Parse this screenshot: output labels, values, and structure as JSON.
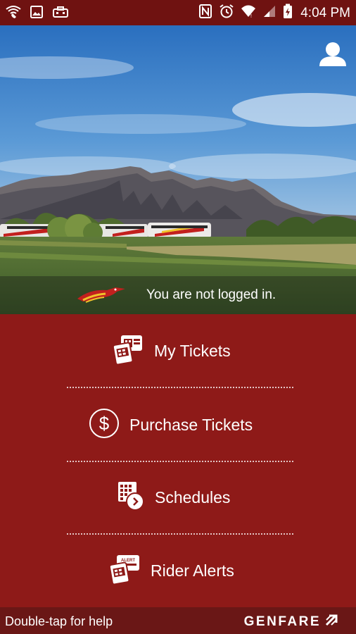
{
  "status_bar": {
    "time": "4:04 PM",
    "left_icons": [
      "wifi-calling-icon",
      "gallery-icon",
      "briefcase-icon"
    ],
    "right_icons": [
      "nfc-icon",
      "alarm-icon",
      "wifi-icon",
      "signal-icon",
      "battery-charging-icon"
    ]
  },
  "header": {
    "login_status": "You are not logged in.",
    "profile_icon": "person-icon",
    "logo_icon": "roadrunner-logo-icon"
  },
  "menu": {
    "items": [
      {
        "label": "My Tickets",
        "icon": "tickets-icon"
      },
      {
        "label": "Purchase Tickets",
        "icon": "dollar-icon"
      },
      {
        "label": "Schedules",
        "icon": "schedule-icon"
      },
      {
        "label": "Rider Alerts",
        "icon": "alert-icon"
      }
    ]
  },
  "footer": {
    "help_text": "Double-tap for help",
    "brand": "GENFARE"
  },
  "colors": {
    "primary": "#8e1a18",
    "status_bar": "#6f1211",
    "footer": "#6a1716",
    "text": "#ffffff"
  }
}
